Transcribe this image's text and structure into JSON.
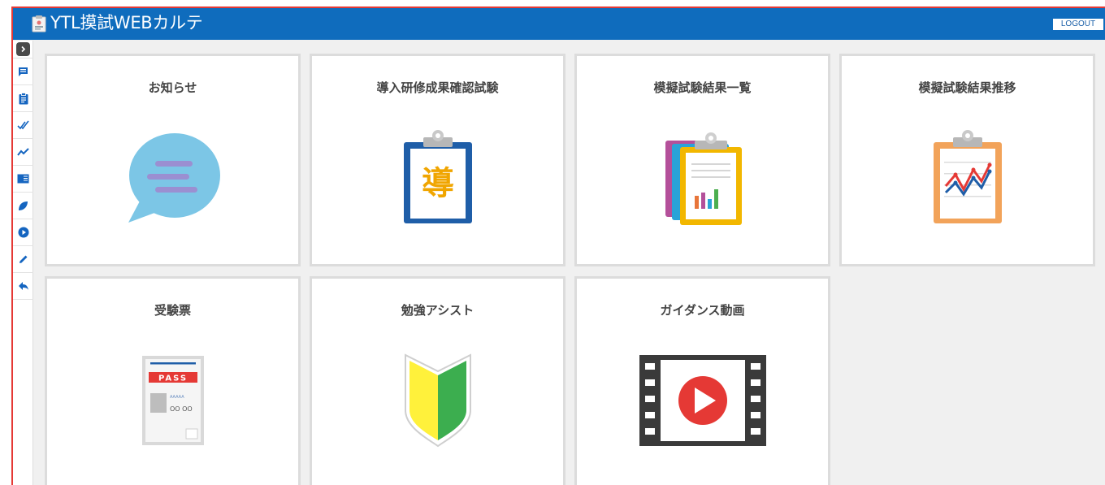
{
  "header": {
    "title": "YTL摸試WEBカルテ",
    "logout_label": "LOGOUT",
    "brand_color": "#0f6cbd"
  },
  "sidebar": {
    "items": [
      {
        "icon": "chevron-right-icon"
      },
      {
        "icon": "message-icon"
      },
      {
        "icon": "clipboard-icon"
      },
      {
        "icon": "double-check-icon"
      },
      {
        "icon": "trend-line-icon"
      },
      {
        "icon": "book-icon"
      },
      {
        "icon": "leaf-icon"
      },
      {
        "icon": "play-circle-icon"
      },
      {
        "icon": "pencil-icon"
      },
      {
        "icon": "reply-icon"
      }
    ]
  },
  "cards": [
    {
      "label": "お知らせ",
      "icon": "speech-bubble-icon"
    },
    {
      "label": "導入研修成果確認試験",
      "icon": "clipboard-doc-icon",
      "icon_text": "導"
    },
    {
      "label": "模擬試験結果一覧",
      "icon": "stacked-reports-icon"
    },
    {
      "label": "模擬試験結果推移",
      "icon": "trend-chart-icon"
    },
    {
      "label": "受験票",
      "icon": "exam-ticket-icon",
      "icon_text": "PASS",
      "ticket_line1": "AAAAA",
      "ticket_line2": "OO OO"
    },
    {
      "label": "勉強アシスト",
      "icon": "beginner-mark-icon"
    },
    {
      "label": "ガイダンス動画",
      "icon": "video-film-icon"
    }
  ]
}
